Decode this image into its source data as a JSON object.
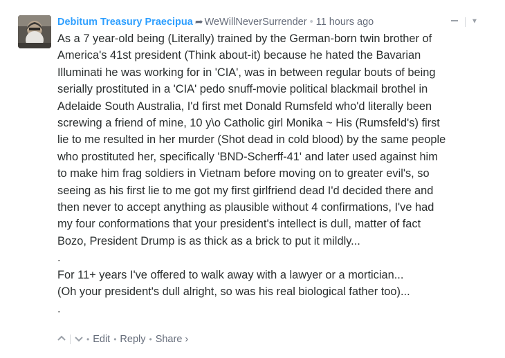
{
  "comment": {
    "author": "Debitum Treasury Praecipua",
    "reply_to": "WeWillNeverSurrender",
    "timestamp": "11 hours ago",
    "lines": [
      "As a 7 year-old being (Literally) trained by the German-born twin brother of",
      "America's 41st president (Think about-it) because he hated the Bavarian",
      "Illuminati he was working for in 'CIA', was in between regular bouts of being",
      "serially prostituted in a 'CIA' pedo snuff-movie political blackmail brothel in",
      "Adelaide South Australia, I'd first met Donald Rumsfeld who'd literally been",
      "screwing a friend of mine, 10 y\\o Catholic girl Monika ~ His (Rumsfeld's) first",
      "lie to me resulted in her murder (Shot dead in cold blood) by the same people",
      "who prostituted her, specifically 'BND-Scherff-41' and later used against him",
      "to make him frag soldiers in Vietnam before moving on to greater evil's, so",
      "seeing as his first lie to me got my first girlfriend dead I'd decided there and",
      "then never to accept anything as plausible without 4 confirmations, I've had",
      "my four conformations that your president's intellect is dull, matter of fact",
      "Bozo, President Drump is as thick as a brick to put it mildly...",
      ".",
      "For 11+ years I've offered to walk away with a lawyer or a mortician...",
      "(Oh your president's dull alright, so was his real biological father too)...",
      "."
    ]
  },
  "footer": {
    "edit_label": "Edit",
    "reply_label": "Reply",
    "share_label": "Share ›"
  },
  "colors": {
    "author": "#2e9fff",
    "meta": "#656c7a",
    "text": "#2a2e2e"
  },
  "icons": {
    "reply_arrow": "reply-arrow-icon",
    "upvote": "chevron-up-icon",
    "downvote": "chevron-down-icon",
    "collapse": "minus-icon",
    "menu": "caret-down-icon"
  }
}
